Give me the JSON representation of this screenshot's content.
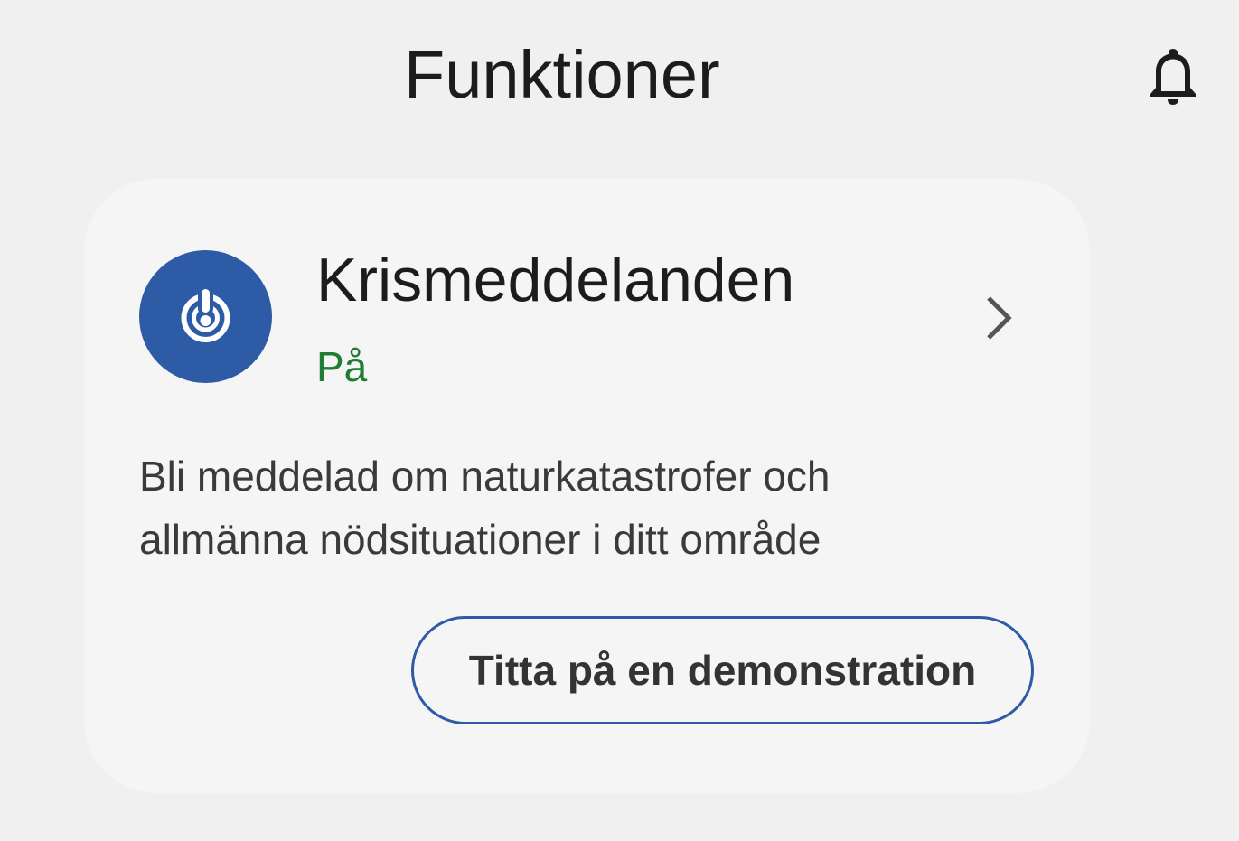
{
  "header": {
    "title": "Funktioner",
    "notification_icon": "bell-icon"
  },
  "feature_card": {
    "icon": "emergency-alert-icon",
    "title": "Krismeddelanden",
    "status": "På",
    "description_line1": "Bli meddelad om naturkatastrofer och",
    "description_line2": "allmänna nödsituationer i ditt område",
    "demo_button_label": "Titta på en demonstration",
    "chevron_icon": "chevron-right-icon"
  },
  "colors": {
    "background": "#f0f0f0",
    "card_background": "#f5f5f5",
    "icon_background": "#2d5ba6",
    "status_on": "#1e7e34",
    "button_border": "#2d5ba6"
  }
}
